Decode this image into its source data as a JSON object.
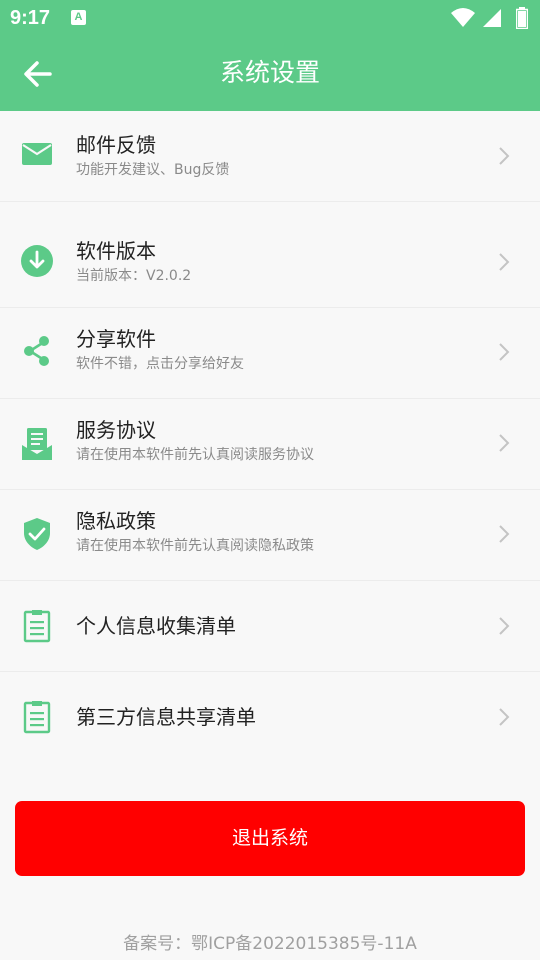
{
  "status_bar": {
    "time": "9:17",
    "notification_badge": "A",
    "icons": [
      "wifi-icon",
      "signal-icon",
      "battery-icon"
    ]
  },
  "header": {
    "title": "系统设置",
    "back_icon": "back-arrow-icon"
  },
  "settings": {
    "items": [
      {
        "title": "邮件反馈",
        "subtitle": "功能开发建议、Bug反馈",
        "icon": "mail-icon"
      },
      {
        "title": "软件版本",
        "subtitle": "当前版本：V2.0.2",
        "icon": "download-icon"
      },
      {
        "title": "分享软件",
        "subtitle": "软件不错，点击分享给好友",
        "icon": "share-icon"
      },
      {
        "title": "服务协议",
        "subtitle": "请在使用本软件前先认真阅读服务协议",
        "icon": "agreement-icon"
      },
      {
        "title": "隐私政策",
        "subtitle": "请在使用本软件前先认真阅读隐私政策",
        "icon": "shield-check-icon"
      },
      {
        "title": "个人信息收集清单",
        "icon": "clipboard-icon"
      },
      {
        "title": "第三方信息共享清单",
        "icon": "clipboard-icon"
      }
    ]
  },
  "logout_label": "退出系统",
  "footer": {
    "icp": "备案号：鄂ICP备2022015385号-11A"
  },
  "colors": {
    "primary": "#5cca88",
    "danger": "#ff0000",
    "background": "#f8f8f8"
  }
}
